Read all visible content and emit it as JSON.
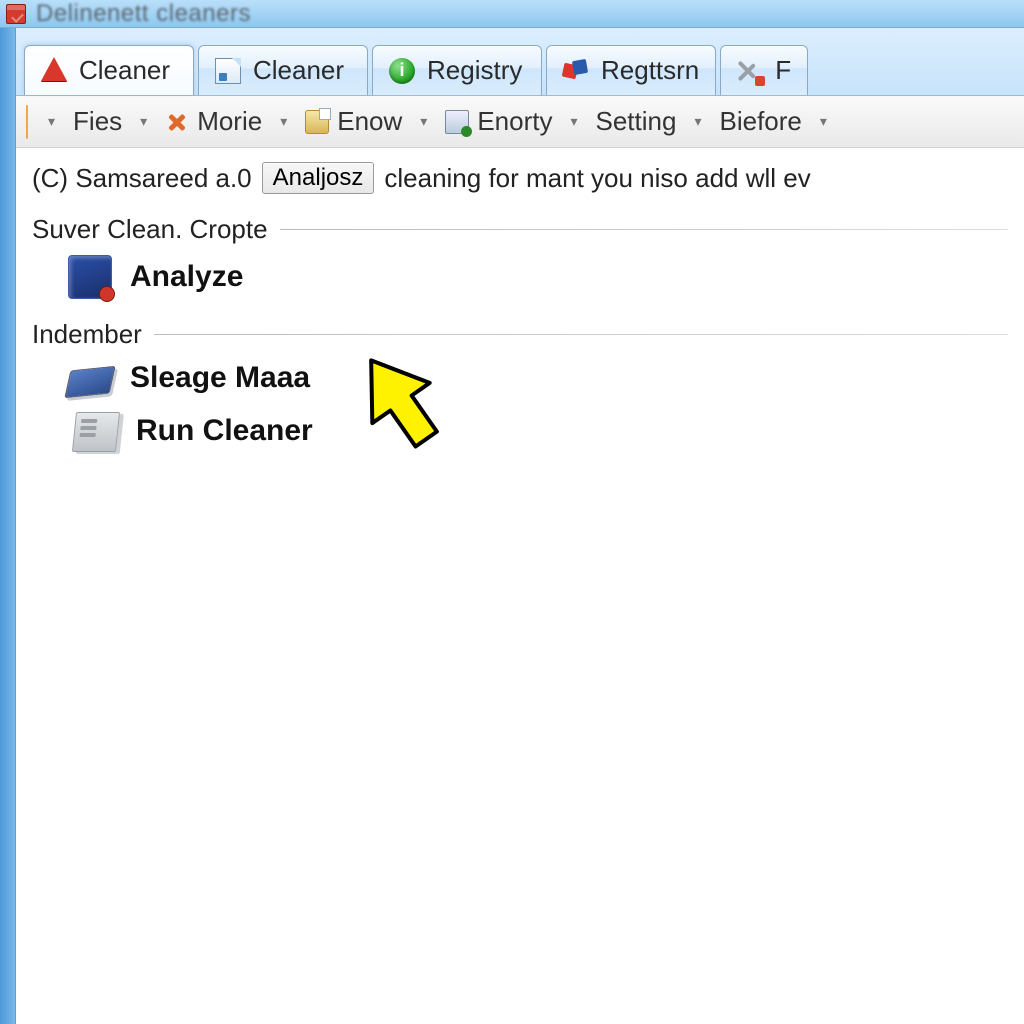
{
  "window": {
    "title": "Delinenett cleaners"
  },
  "tabs": [
    {
      "label": "Cleaner",
      "icon": "warn"
    },
    {
      "label": "Cleaner",
      "icon": "doc"
    },
    {
      "label": "Registry",
      "icon": "green"
    },
    {
      "label": "Regttsrn",
      "icon": "puzzle"
    },
    {
      "label": "F",
      "icon": "tools"
    }
  ],
  "toolbar": {
    "items": [
      {
        "label": "Fies",
        "icon": ""
      },
      {
        "label": "Morie",
        "icon": "x"
      },
      {
        "label": "Enow",
        "icon": "box"
      },
      {
        "label": "Enorty",
        "icon": "mon"
      },
      {
        "label": "Setting",
        "icon": ""
      },
      {
        "label": "Biefore",
        "icon": ""
      }
    ]
  },
  "status": {
    "prefix": "(C) Samsareed a.0",
    "button": "Analjosz",
    "suffix": "cleaning for mant you niso add wll ev"
  },
  "groups": [
    {
      "title": "Suver Clean. Cropte",
      "items": [
        {
          "label": "Analyze",
          "icon": "computer"
        }
      ]
    },
    {
      "title": "Indember",
      "items": [
        {
          "label": "Sleage Maaa",
          "icon": "drive"
        },
        {
          "label": "Run Cleaner",
          "icon": "tower"
        }
      ]
    }
  ]
}
